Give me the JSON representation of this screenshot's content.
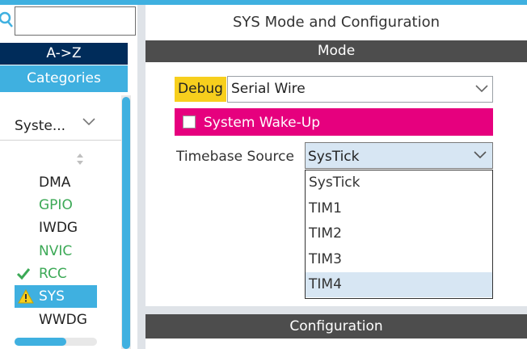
{
  "left_panel": {
    "search": {
      "value": "",
      "placeholder": ""
    },
    "az_button": "A->Z",
    "categories_tab": "Categories",
    "category_select": "Syste...",
    "items": [
      {
        "label": "DMA",
        "state": "normal"
      },
      {
        "label": "GPIO",
        "state": "configured"
      },
      {
        "label": "IWDG",
        "state": "normal"
      },
      {
        "label": "NVIC",
        "state": "configured"
      },
      {
        "label": "RCC",
        "state": "checked"
      },
      {
        "label": "SYS",
        "state": "warning-selected"
      },
      {
        "label": "WWDG",
        "state": "normal"
      }
    ]
  },
  "main": {
    "title": "SYS Mode and Configuration",
    "mode_header": "Mode",
    "debug": {
      "label": "Debug",
      "value": "Serial Wire"
    },
    "wakeup": {
      "label": "System Wake-Up",
      "checked": false
    },
    "timebase": {
      "label": "Timebase Source",
      "value": "SysTick",
      "options": [
        "SysTick",
        "TIM1",
        "TIM2",
        "TIM3",
        "TIM4"
      ],
      "highlighted": "TIM4"
    },
    "config_header": "Configuration"
  },
  "colors": {
    "accent_blue": "#3fb0e0",
    "navy": "#002c5a",
    "header_gray": "#4d4d4d",
    "debug_yellow": "#f7cf1d",
    "wakeup_magenta": "#e6007e",
    "configured_green": "#3ca956",
    "select_highlight": "#d7e6f3"
  },
  "icons": {
    "search": "search-icon",
    "chevron": "chevron-down-icon",
    "sort": "sort-icon",
    "check": "check-icon",
    "warning": "warning-icon"
  }
}
